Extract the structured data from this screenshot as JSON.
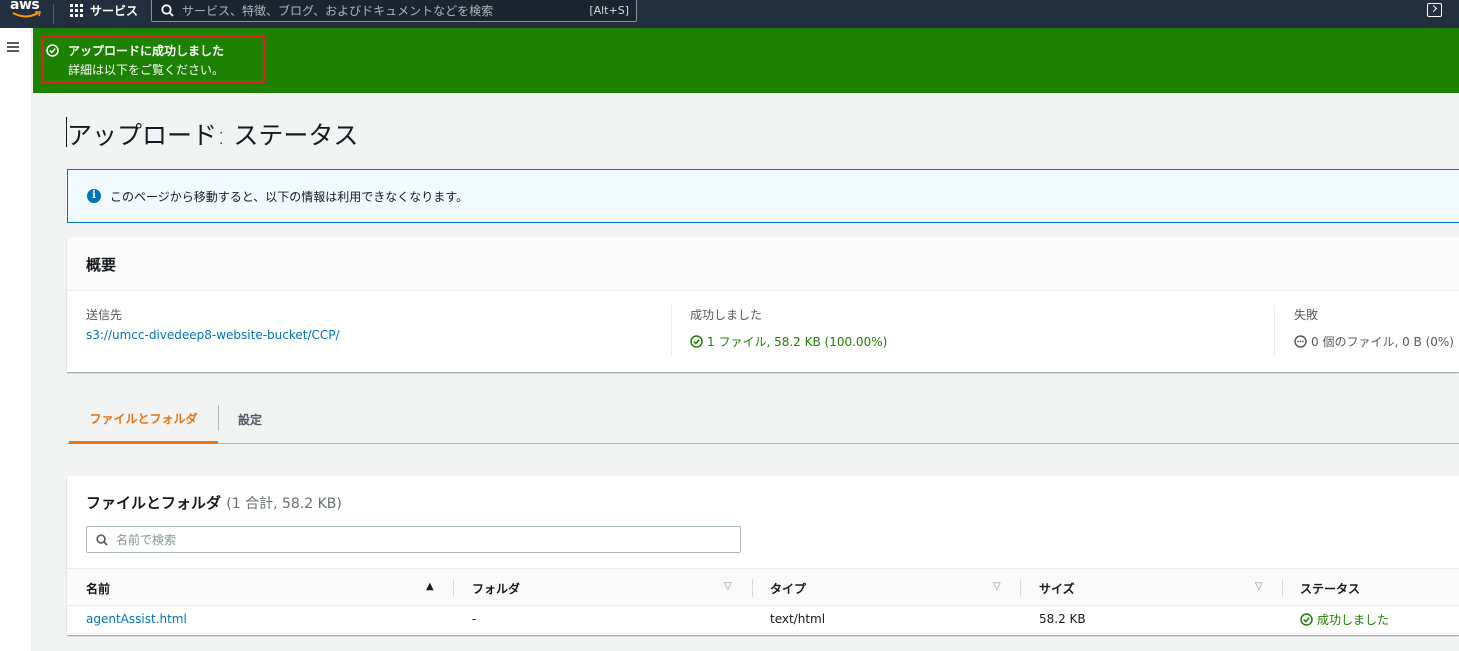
{
  "topnav": {
    "logo": "aws",
    "services_label": "サービス",
    "search_placeholder": "サービス、特徴、ブログ、およびドキュメントなどを検索",
    "search_shortcut": "[Alt+S]"
  },
  "flash": {
    "title": "アップロードに成功しました",
    "subtitle": "詳細は以下をご覧ください。",
    "color": "#1d8102"
  },
  "page": {
    "title": "アップロード: ステータス",
    "info": "このページから移動すると、以下の情報は利用できなくなります。"
  },
  "summary": {
    "heading": "概要",
    "destination_label": "送信先",
    "destination_value": "s3://umcc-divedeep8-website-bucket/CCP/",
    "success_label": "成功しました",
    "success_value": "1 ファイル, 58.2 KB (100.00%)",
    "failed_label": "失敗",
    "failed_value": "0 個のファイル, 0 B (0%)"
  },
  "tabs": [
    {
      "label": "ファイルとフォルダ",
      "active": true
    },
    {
      "label": "設定",
      "active": false
    }
  ],
  "files": {
    "title": "ファイルとフォルダ",
    "count": "(1 合計, 58.2 KB)",
    "search_placeholder": "名前で検索",
    "columns": [
      "名前",
      "フォルダ",
      "タイプ",
      "サイズ",
      "ステータス"
    ],
    "rows": [
      {
        "name": "agentAssist.html",
        "folder": "-",
        "type": "text/html",
        "size": "58.2 KB",
        "status": "成功しました"
      }
    ]
  },
  "colors": {
    "accent": "#ec7211",
    "link": "#0073bb",
    "success": "#1d8102"
  }
}
